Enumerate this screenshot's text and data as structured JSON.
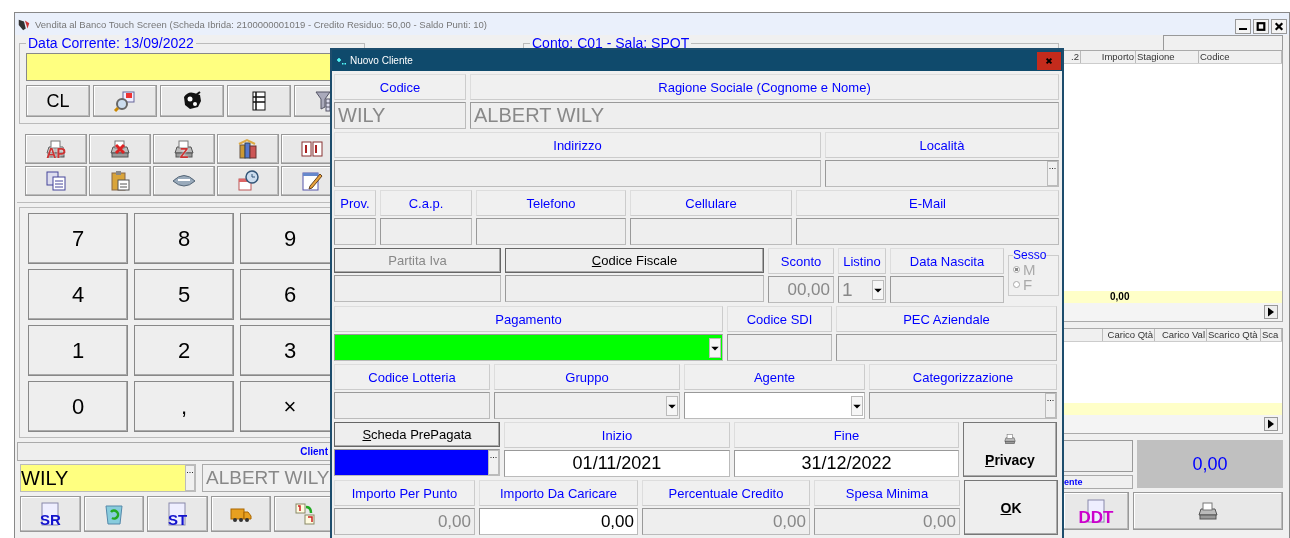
{
  "window": {
    "title": "Vendita al Banco Touch Screen (Scheda Ibrida: 2100000001019 - Credito Residuo: 50,00 - Saldo Punti: 10)"
  },
  "left": {
    "date_legend": "Data Corrente: 13/09/2022",
    "toolbar": [
      {
        "kind": "text",
        "label": "CL"
      },
      {
        "kind": "icon"
      },
      {
        "kind": "icon"
      },
      {
        "kind": "icon"
      },
      {
        "kind": "icon"
      }
    ],
    "tools": [
      {
        "kind": "labeled",
        "label": "AP"
      },
      {
        "kind": "icon"
      },
      {
        "kind": "labeled",
        "label": "Z"
      },
      {
        "kind": "icon"
      },
      {
        "kind": "icon"
      },
      {
        "kind": "icon"
      },
      {
        "kind": "icon"
      },
      {
        "kind": "icon"
      },
      {
        "kind": "icon"
      },
      {
        "kind": "icon"
      }
    ],
    "keypad": [
      "7",
      "8",
      "9",
      "4",
      "5",
      "6",
      "1",
      "2",
      "3",
      "0",
      ",",
      "×"
    ],
    "client_bar": "Client",
    "customer": {
      "code": "WILY",
      "button_text": "...",
      "name": "ALBERT WILY"
    },
    "bottom": [
      {
        "kind": "labeled",
        "label": "SR"
      },
      {
        "kind": "icon"
      },
      {
        "kind": "labeled",
        "label": "ST"
      },
      {
        "kind": "icon"
      },
      {
        "kind": "icon"
      }
    ]
  },
  "center": {
    "legend": "Conto: C01 - Sala: SPOT"
  },
  "right": {
    "grid1": {
      "columns": [
        ".2",
        "Importo",
        "Stagione",
        "Codice"
      ],
      "total": "0,00"
    },
    "grid2": {
      "columns": [
        "Carico Qtà",
        "Carico Val",
        "Scarico Qtà",
        "Sca"
      ]
    },
    "client_label": "ente",
    "total": "0,00",
    "ddt": "DDT"
  },
  "dialog": {
    "title": "Nuovo Cliente",
    "sections": [
      {
        "cols": [
          {
            "kind": "text",
            "label": "Codice",
            "value": "WILY",
            "editable": false
          },
          {
            "kind": "text",
            "label": "Ragione Sociale (Cognome e Nome)",
            "value": "ALBERT WILY",
            "editable": false
          }
        ]
      },
      {
        "cols": [
          {
            "kind": "text",
            "label": "Indirizzo",
            "editable": false
          },
          {
            "kind": "lookup",
            "label": "Località",
            "button_text": "...",
            "editable": false
          }
        ]
      },
      {
        "cols": [
          {
            "kind": "text",
            "label": "Prov.",
            "editable": false
          },
          {
            "kind": "text",
            "label": "C.a.p.",
            "editable": false
          },
          {
            "kind": "text",
            "label": "Telefono",
            "editable": false
          },
          {
            "kind": "text",
            "label": "Cellulare",
            "editable": false
          },
          {
            "kind": "text",
            "label": "E-Mail",
            "editable": false
          }
        ]
      },
      {
        "cols": [
          {
            "kind": "text",
            "header_button": true,
            "label": "Partita Iva",
            "disabled": true,
            "accel": false,
            "editable": false
          },
          {
            "kind": "text",
            "header_button": true,
            "label": "Codice Fiscale",
            "disabled": false,
            "accel": true,
            "editable": false
          },
          {
            "kind": "number",
            "label": "Sconto",
            "value": "00,00",
            "editable": false
          },
          {
            "kind": "combo",
            "label": "Listino",
            "value": "1",
            "editable": false
          },
          {
            "kind": "text",
            "label": "Data Nascita",
            "editable": false
          },
          {
            "kind": "radio",
            "label": "Sesso",
            "disabled": true,
            "options": [
              {
                "label": "M",
                "selected": true
              },
              {
                "label": "F",
                "selected": false
              }
            ]
          }
        ]
      },
      {
        "cols": [
          {
            "kind": "combo",
            "label": "Pagamento",
            "color": "#00ff00"
          },
          {
            "kind": "text",
            "label": "Codice SDI",
            "editable": false
          },
          {
            "kind": "text",
            "label": "PEC Aziendale",
            "editable": false
          }
        ]
      },
      {
        "cols": [
          {
            "kind": "text",
            "label": "Codice Lotteria",
            "editable": false
          },
          {
            "kind": "combo",
            "label": "Gruppo",
            "editable": false
          },
          {
            "kind": "combo",
            "label": "Agente",
            "editable": true
          },
          {
            "kind": "lookup",
            "label": "Categorizzazione",
            "button_text": "...",
            "editable": false
          }
        ]
      },
      {
        "cols": [
          {
            "kind": "lookup",
            "header_button": true,
            "label": "Scheda PrePagata",
            "disabled": false,
            "accel": true,
            "button_text": "...",
            "color": "#0000ff"
          },
          {
            "kind": "date",
            "label": "Inizio",
            "value": "01/11/2021",
            "editable": true
          },
          {
            "kind": "date",
            "label": "Fine",
            "value": "31/12/2022",
            "editable": true
          },
          {
            "kind": "action",
            "label": "Privacy",
            "accel": true,
            "icon": true
          }
        ]
      },
      {
        "cols": [
          {
            "kind": "number",
            "label": "Importo Per Punto",
            "value": "0,00",
            "editable": false
          },
          {
            "kind": "number",
            "label": "Importo Da Caricare",
            "value": "0,00",
            "editable": true
          },
          {
            "kind": "number",
            "label": "Percentuale Credito",
            "value": "0,00",
            "editable": false
          },
          {
            "kind": "number",
            "label": "Spesa Minima",
            "value": "0,00",
            "editable": false
          },
          {
            "kind": "action",
            "label": "OK",
            "accel": true,
            "icon": false
          }
        ]
      }
    ]
  }
}
